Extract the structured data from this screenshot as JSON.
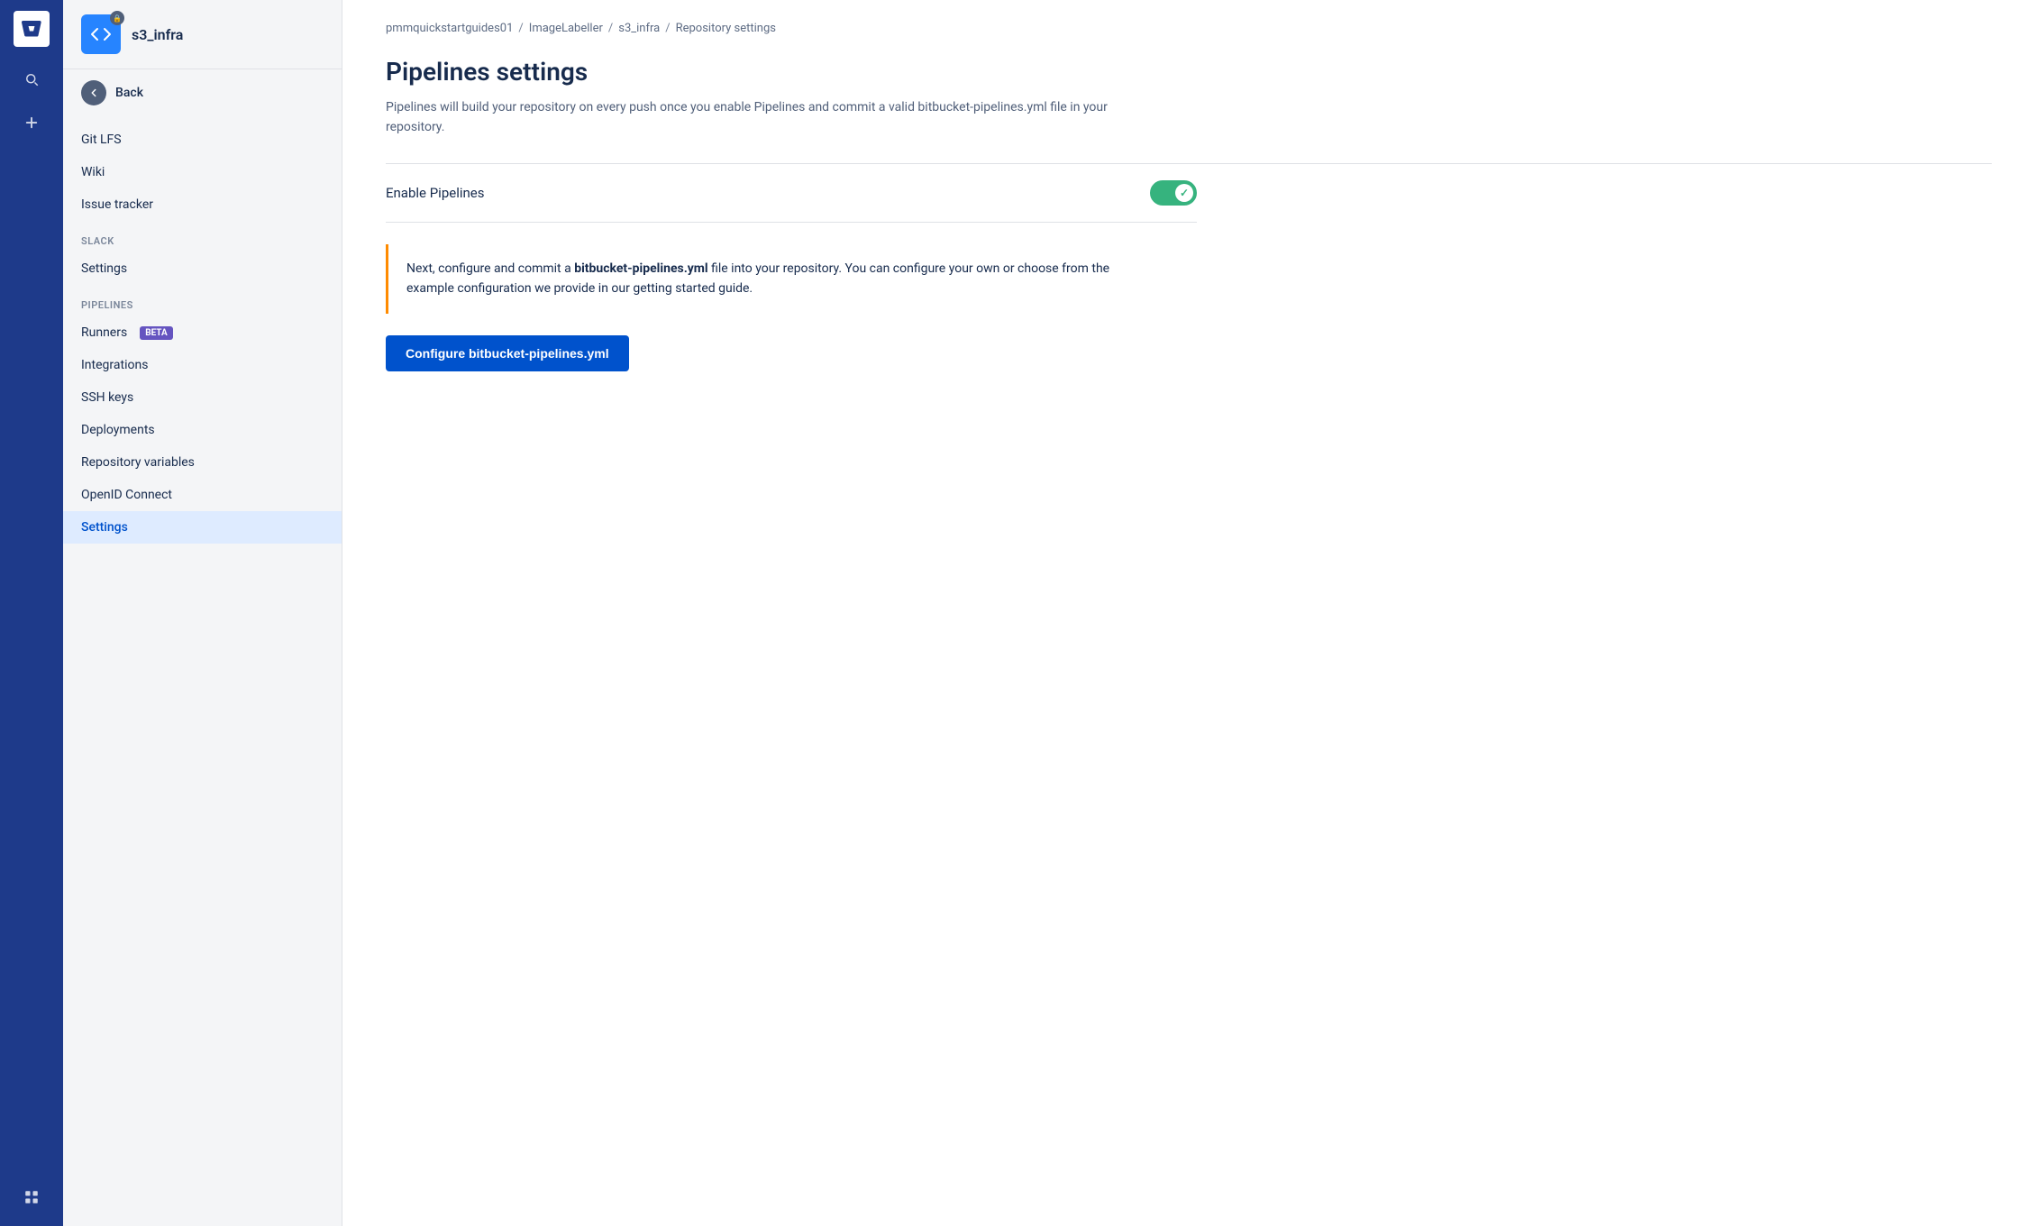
{
  "globalNav": {
    "logoAlt": "Bitbucket logo"
  },
  "sidebar": {
    "repoName": "s3_infra",
    "backLabel": "Back",
    "navItems": [
      {
        "id": "git-lfs",
        "label": "Git LFS",
        "active": false
      },
      {
        "id": "wiki",
        "label": "Wiki",
        "active": false
      },
      {
        "id": "issue-tracker",
        "label": "Issue tracker",
        "active": false
      }
    ],
    "sections": [
      {
        "id": "slack",
        "label": "SLACK",
        "items": [
          {
            "id": "slack-settings",
            "label": "Settings",
            "active": false
          }
        ]
      },
      {
        "id": "pipelines",
        "label": "PIPELINES",
        "items": [
          {
            "id": "runners",
            "label": "Runners",
            "badge": "BETA",
            "active": false
          },
          {
            "id": "integrations",
            "label": "Integrations",
            "active": false
          },
          {
            "id": "ssh-keys",
            "label": "SSH keys",
            "active": false
          },
          {
            "id": "deployments",
            "label": "Deployments",
            "active": false
          },
          {
            "id": "repo-variables",
            "label": "Repository variables",
            "active": false
          },
          {
            "id": "openid",
            "label": "OpenID Connect",
            "active": false
          },
          {
            "id": "settings",
            "label": "Settings",
            "active": true
          }
        ]
      }
    ]
  },
  "breadcrumb": {
    "items": [
      "pmmquickstartguides01",
      "ImageLabeller",
      "s3_infra",
      "Repository settings"
    ],
    "separators": [
      "/",
      "/",
      "/"
    ]
  },
  "main": {
    "title": "Pipelines settings",
    "description": "Pipelines will build your repository on every push once you enable Pipelines and commit a valid bitbucket-pipelines.yml file in your repository.",
    "enableLabel": "Enable Pipelines",
    "toggleEnabled": true,
    "infoText1": "Next, configure and commit a ",
    "infoFilename": "bitbucket-pipelines.yml",
    "infoText2": " file into your repository. You can configure your own or choose from the example configuration we provide in our getting started guide.",
    "configureButton": "Configure bitbucket-pipelines.yml"
  }
}
